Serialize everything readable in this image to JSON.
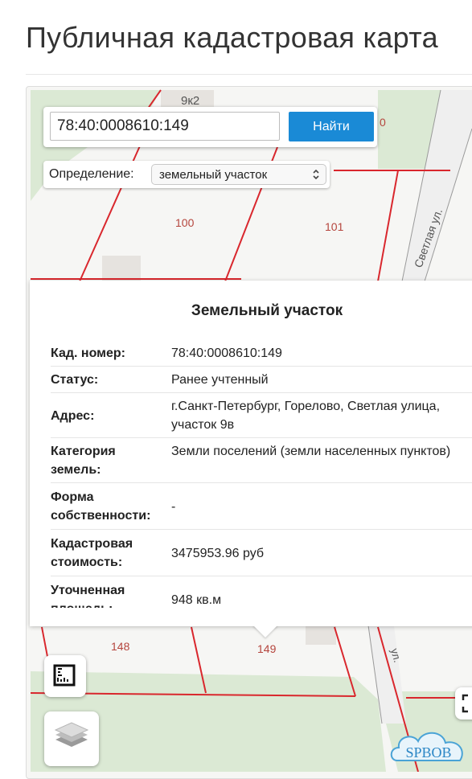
{
  "page": {
    "title": "Публичная кадастровая карта"
  },
  "colors": {
    "accent": "#1a8ad6",
    "parcel_border": "#d9272d",
    "greenery": "#dbe9d4",
    "map_bg": "#f6f6f4"
  },
  "search": {
    "value": "78:40:0008610:149",
    "button_label": "Найти"
  },
  "definition": {
    "label": "Определение:",
    "selected": "земельный участок"
  },
  "map": {
    "labels": {
      "building": "9к2",
      "parcel_100": "100",
      "parcel_101": "101",
      "parcel_148": "148",
      "parcel_149": "149",
      "partial_digit": "0",
      "street": "Светлая ул.",
      "street_partial": "ул."
    },
    "buttons": [
      "ruler-icon",
      "layers-icon",
      "fullscreen-icon"
    ]
  },
  "popup": {
    "title": "Земельный участок",
    "rows": [
      {
        "key": "Кад. номер:",
        "value": "78:40:0008610:149"
      },
      {
        "key": "Статус:",
        "value": "Ранее учтенный"
      },
      {
        "key": "Адрес:",
        "value": "г.Санкт-Петербург, Горелово, Светлая улица, участок 9в"
      },
      {
        "key": "Категория земель:",
        "value": "Земли поселений (земли населенных пунктов)"
      },
      {
        "key": "Форма собственности:",
        "value": "-"
      },
      {
        "key": "Кадастровая стоимость:",
        "value": "3475953.96 руб"
      },
      {
        "key": "Уточненная площадь:",
        "value": "948 кв.м"
      }
    ]
  },
  "watermark": {
    "text": "SPBOB"
  }
}
